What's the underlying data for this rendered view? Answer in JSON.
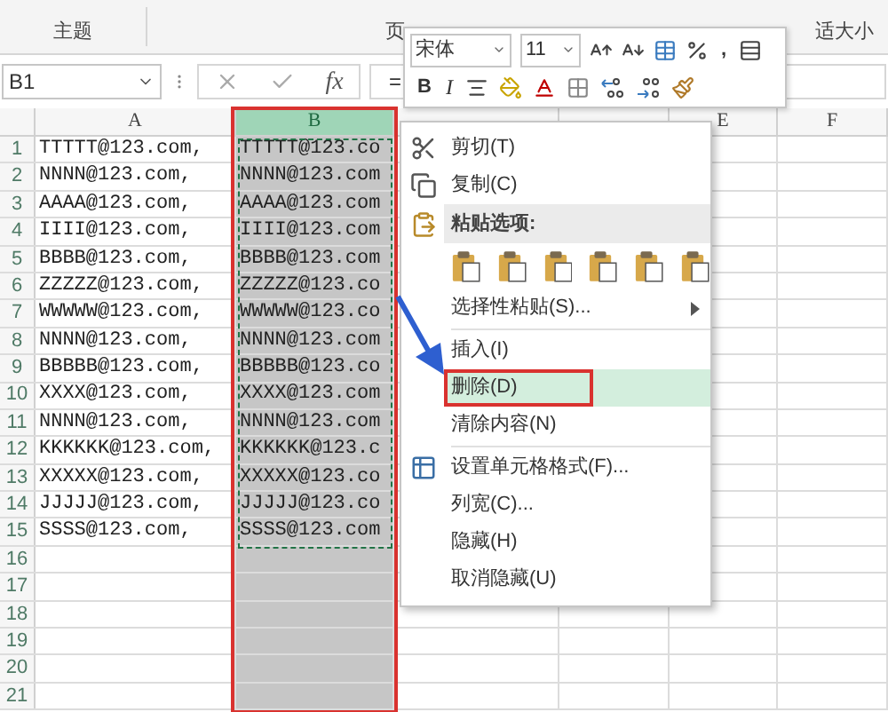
{
  "ribbon": {
    "groups": [
      {
        "label": "主题"
      },
      {
        "label": "页"
      },
      {
        "label": "适大小"
      }
    ]
  },
  "formula_bar": {
    "name_box": "B1",
    "fx": "fx",
    "formula": "="
  },
  "mini_toolbar": {
    "font": "宋体",
    "size": "11",
    "comma": ",",
    "bold": "B",
    "italic": "I"
  },
  "sheet": {
    "columns": [
      {
        "label": "A",
        "selected": false
      },
      {
        "label": "B",
        "selected": true,
        "annotated": true
      },
      {
        "selected": false
      },
      {
        "selected": false
      },
      {
        "label": "E",
        "selected": false
      },
      {
        "label": "F",
        "selected": false
      }
    ],
    "rows": [
      {
        "number": "1",
        "cells": [
          "TTTTT@123.com,",
          "TTTTT@123.co"
        ]
      },
      {
        "number": "2",
        "cells": [
          "NNNN@123.com,",
          "NNNN@123.com"
        ]
      },
      {
        "number": "3",
        "cells": [
          "AAAA@123.com,",
          "AAAA@123.com"
        ]
      },
      {
        "number": "4",
        "cells": [
          "IIII@123.com,",
          "IIII@123.com"
        ]
      },
      {
        "number": "5",
        "cells": [
          "BBBB@123.com,",
          "BBBB@123.com"
        ]
      },
      {
        "number": "6",
        "cells": [
          "ZZZZZ@123.com,",
          "ZZZZZ@123.co"
        ]
      },
      {
        "number": "7",
        "cells": [
          "WWWWW@123.com,",
          "WWWWW@123.co"
        ]
      },
      {
        "number": "8",
        "cells": [
          "NNNN@123.com,",
          "NNNN@123.com"
        ]
      },
      {
        "number": "9",
        "cells": [
          "BBBBB@123.com,",
          "BBBBB@123.co"
        ]
      },
      {
        "number": "10",
        "cells": [
          "XXXX@123.com,",
          "XXXX@123.com"
        ]
      },
      {
        "number": "11",
        "cells": [
          "NNNN@123.com,",
          "NNNN@123.com"
        ]
      },
      {
        "number": "12",
        "cells": [
          "KKKKKK@123.com,",
          "KKKKKK@123.c"
        ]
      },
      {
        "number": "13",
        "cells": [
          "XXXXX@123.com,",
          "XXXXX@123.co"
        ]
      },
      {
        "number": "14",
        "cells": [
          "JJJJJ@123.com,",
          "JJJJJ@123.co"
        ]
      },
      {
        "number": "15",
        "cells": [
          "SSSS@123.com,",
          "SSSS@123.com"
        ]
      },
      {
        "number": "16",
        "cells": []
      },
      {
        "number": "17",
        "cells": []
      },
      {
        "number": "18",
        "cells": []
      },
      {
        "number": "19",
        "cells": []
      },
      {
        "number": "20",
        "cells": []
      },
      {
        "number": "21",
        "cells": []
      }
    ]
  },
  "context_menu": {
    "items": [
      {
        "kind": "item",
        "label": "剪切(T)",
        "highlighted": false
      },
      {
        "kind": "item",
        "label": "复制(C)",
        "highlighted": false
      },
      {
        "kind": "header",
        "label": "粘贴选项:"
      },
      {
        "kind": "paste_icons"
      },
      {
        "kind": "item",
        "label": "选择性粘贴(S)...",
        "highlighted": false,
        "has_submenu": true
      },
      {
        "kind": "separator"
      },
      {
        "kind": "item",
        "label": "插入(I)",
        "highlighted": false
      },
      {
        "kind": "item",
        "label": "删除(D)",
        "highlighted": true,
        "annotated": true
      },
      {
        "kind": "item",
        "label": "清除内容(N)",
        "highlighted": false
      },
      {
        "kind": "separator"
      },
      {
        "kind": "item",
        "label": "设置单元格格式(F)...",
        "highlighted": false
      },
      {
        "kind": "item",
        "label": "列宽(C)...",
        "highlighted": false
      },
      {
        "kind": "item",
        "label": "隐藏(H)",
        "highlighted": false
      },
      {
        "kind": "item",
        "label": "取消隐藏(U)",
        "highlighted": false
      }
    ]
  }
}
